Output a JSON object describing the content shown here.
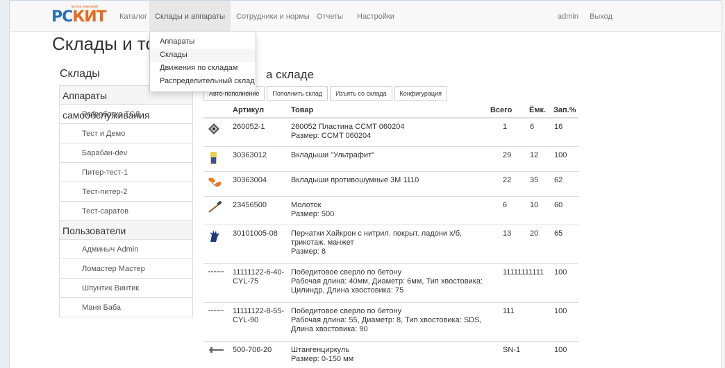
{
  "logo": {
    "text_blue": "РС",
    "text_orange": "КИТ",
    "tagline": "группа компаний"
  },
  "nav": {
    "items": [
      "Каталог",
      "Склады и аппараты",
      "Сотрудники и нормы",
      "Отчеты",
      "Настройки"
    ],
    "user": "admin",
    "logout": "Выход"
  },
  "dropdown": [
    "Аппараты",
    "Склады",
    "Движения по складам",
    "Распределительный склад"
  ],
  "page_title": "Склады и то",
  "sidebar": {
    "title": "Склады",
    "group1": "Аппараты самообслуживания",
    "group1_items": [
      "Разработка ТСД",
      "Тест и Демо",
      "Барабан-dev",
      "Питер-тест-1",
      "Тест-питер-2",
      "Тест-саратов"
    ],
    "group2": "Пользователи",
    "group2_items": [
      "Админыч Admin",
      "Ломастер Мастер",
      "Шпунтик Винтик",
      "Маня Баба"
    ]
  },
  "main": {
    "title": "а складе",
    "buttons": [
      "Авто-пополнение",
      "Пополнить склад",
      "Изъять со склада",
      "Конфигурация"
    ]
  },
  "table": {
    "headers": {
      "article": "Артикул",
      "product": "Товар",
      "total": "Всего",
      "capacity": "Ёмк.",
      "fill": "Зап.%"
    },
    "rows": [
      {
        "icon": "insert-plate-icon",
        "article": "260052-1",
        "name": "260052 Пластина CCMT 060204",
        "sub": "Размер: CCMT 060204",
        "total": "1",
        "cap": "6",
        "pct": "16"
      },
      {
        "icon": "insoles-icon",
        "article": "30363012",
        "name": "Вкладыши \"Ультрафит\"",
        "sub": "",
        "total": "29",
        "cap": "12",
        "pct": "100"
      },
      {
        "icon": "earplugs-icon",
        "article": "30363004",
        "name": "Вкладыши противошумные 3М 1110",
        "sub": "",
        "total": "22",
        "cap": "35",
        "pct": "62"
      },
      {
        "icon": "hammer-icon",
        "article": "23456500",
        "name": "Молоток",
        "sub": "Размер: 500",
        "total": "6",
        "cap": "10",
        "pct": "60"
      },
      {
        "icon": "gloves-icon",
        "article": "30101005-08",
        "name": "Перчатки Хайкрон с нитрил. покрыт. ладони х/б, трикотаж. манжет",
        "sub": "Размер: 8",
        "total": "13",
        "cap": "20",
        "pct": "65"
      },
      {
        "icon": "drill-icon",
        "article": "11111122-6-40-CYL-75",
        "name": "Победитовое сверло по бетону",
        "sub": "Рабочая длина: 40мм, Диаметр: 6мм, Тип хвостовика: Цилиндр, Длина хвостовика: 75",
        "total": "11111111111",
        "cap": "",
        "pct": "100"
      },
      {
        "icon": "drill-icon",
        "article": "11111122-8-55-CYL-90",
        "name": "Победитовое сверло по бетону",
        "sub": "Рабочая длина: 55, Диаметр: 8, Тип хвостовика: SDS, Длина хвостовика: 90",
        "total": "111",
        "cap": "",
        "pct": "100"
      },
      {
        "icon": "caliper-icon",
        "article": "500-706-20",
        "name": "Штангенциркуль",
        "sub": "Размер: 0-150 мм",
        "total": "SN-1",
        "cap": "",
        "pct": "100"
      }
    ]
  }
}
